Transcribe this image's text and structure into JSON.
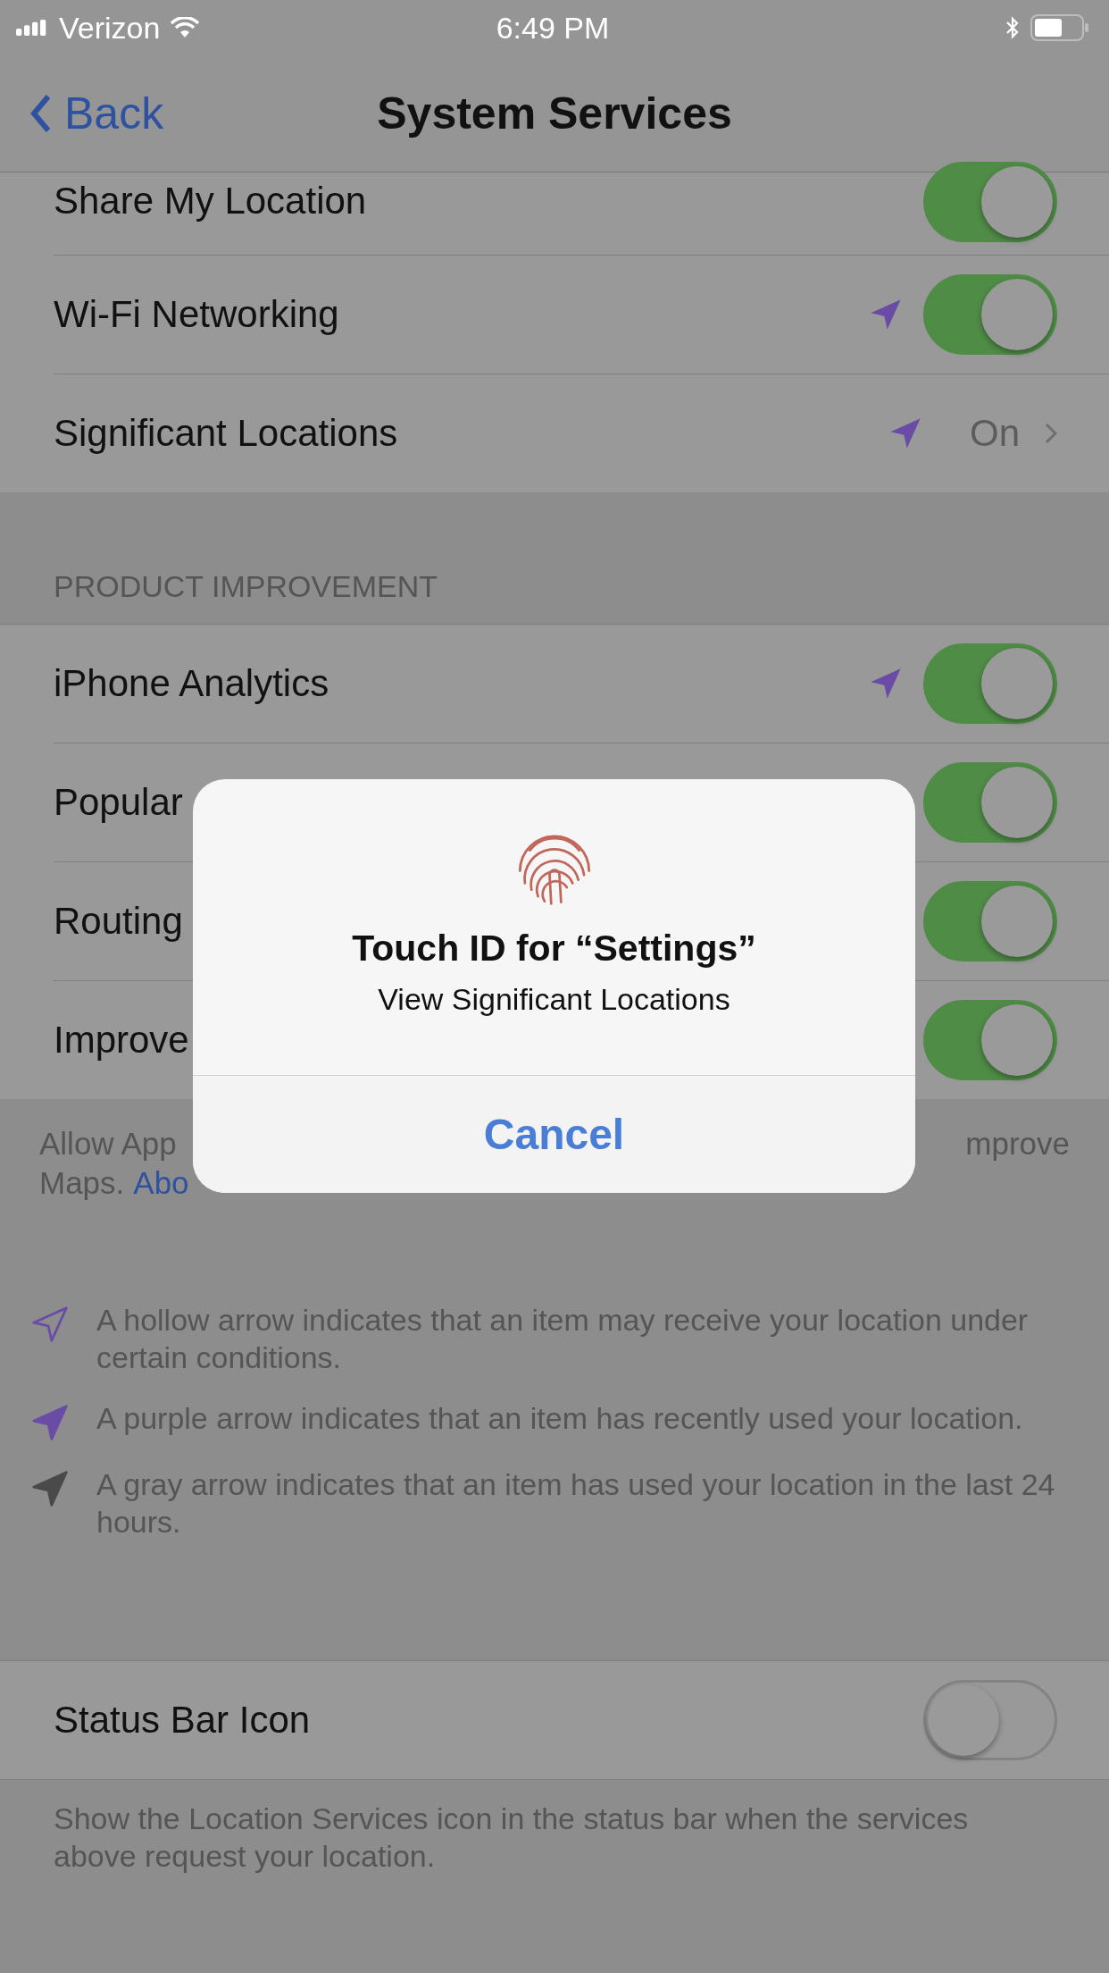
{
  "status_bar": {
    "carrier": "Verizon",
    "time": "6:49 PM"
  },
  "nav": {
    "back": "Back",
    "title": "System Services"
  },
  "top_rows": [
    {
      "label": "Share My Location",
      "kind": "toggle",
      "on": true
    },
    {
      "label": "Wi-Fi Networking",
      "kind": "toggle",
      "on": true,
      "color": "#6a4ca6"
    },
    {
      "label": "Significant Locations",
      "kind": "link",
      "value": "On",
      "color": "#6a4ca6"
    }
  ],
  "section_header": "PRODUCT IMPROVEMENT",
  "improvement_rows": [
    {
      "label": "iPhone Analytics",
      "kind": "toggle",
      "on": true,
      "color": "#6a4ca6"
    },
    {
      "label": "Popular",
      "kind": "toggle",
      "on": true
    },
    {
      "label": "Routing",
      "kind": "toggle",
      "on": true
    },
    {
      "label": "Improve",
      "kind": "toggle",
      "on": true
    }
  ],
  "improvement_footer": {
    "line_1_start": "Allow App",
    "line_1_end": "mprove",
    "line_2_start": "Maps.",
    "line_2_link": "Abo"
  },
  "legend": [
    {
      "kind": "hollow",
      "text": "A hollow arrow indicates that an item may receive your location under certain conditions."
    },
    {
      "kind": "purple",
      "text": "A purple arrow indicates that an item has recently used your location."
    },
    {
      "kind": "gray",
      "text": "A gray arrow indicates that an item has used your location in the last 24 hours."
    }
  ],
  "status_icon_row": {
    "label": "Status Bar Icon",
    "on": false
  },
  "status_icon_footer": "Show the Location Services icon in the status bar when the services above request your location.",
  "dialog": {
    "title": "Touch ID for “Settings”",
    "message": "View Significant Locations",
    "button": "Cancel"
  }
}
